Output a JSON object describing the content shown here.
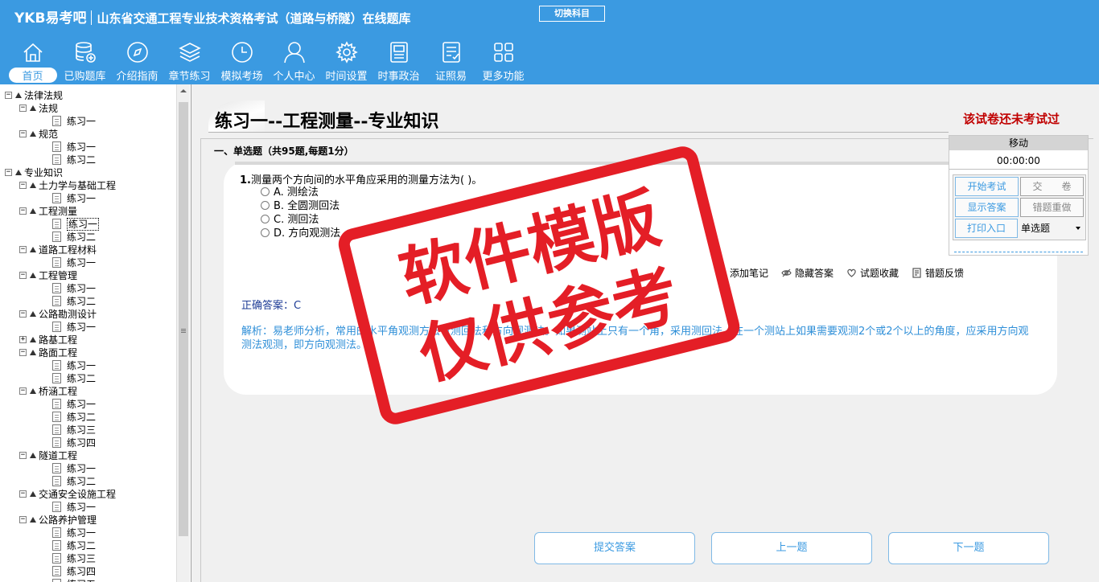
{
  "header": {
    "brand": "YKB易考吧",
    "title": "山东省交通工程专业技术资格考试（道路与桥隧）在线题库",
    "switch_label": "切换科目"
  },
  "toolbar": [
    {
      "label": "首页",
      "icon": "home-icon"
    },
    {
      "label": "已购题库",
      "icon": "database-icon"
    },
    {
      "label": "介绍指南",
      "icon": "compass-icon"
    },
    {
      "label": "章节练习",
      "icon": "layers-icon"
    },
    {
      "label": "模拟考场",
      "icon": "clock-icon"
    },
    {
      "label": "个人中心",
      "icon": "user-icon"
    },
    {
      "label": "时间设置",
      "icon": "gear-icon"
    },
    {
      "label": "时事政治",
      "icon": "news-icon"
    },
    {
      "label": "证照易",
      "icon": "checklist-icon"
    },
    {
      "label": "更多功能",
      "icon": "grid-icon"
    }
  ],
  "tree": [
    {
      "level": 0,
      "label": "法律法规",
      "type": "folder"
    },
    {
      "level": 1,
      "label": "法规",
      "type": "folder"
    },
    {
      "level": 2,
      "label": "练习一",
      "type": "doc"
    },
    {
      "level": 1,
      "label": "规范",
      "type": "folder"
    },
    {
      "level": 2,
      "label": "练习一",
      "type": "doc"
    },
    {
      "level": 2,
      "label": "练习二",
      "type": "doc"
    },
    {
      "level": 0,
      "label": "专业知识",
      "type": "folder"
    },
    {
      "level": 1,
      "label": "土力学与基础工程",
      "type": "folder"
    },
    {
      "level": 2,
      "label": "练习一",
      "type": "doc"
    },
    {
      "level": 1,
      "label": "工程测量",
      "type": "folder"
    },
    {
      "level": 2,
      "label": "练习一",
      "type": "doc",
      "selected": true
    },
    {
      "level": 2,
      "label": "练习二",
      "type": "doc"
    },
    {
      "level": 1,
      "label": "道路工程材料",
      "type": "folder"
    },
    {
      "level": 2,
      "label": "练习一",
      "type": "doc"
    },
    {
      "level": 1,
      "label": "工程管理",
      "type": "folder"
    },
    {
      "level": 2,
      "label": "练习一",
      "type": "doc"
    },
    {
      "level": 2,
      "label": "练习二",
      "type": "doc"
    },
    {
      "level": 1,
      "label": "公路勘测设计",
      "type": "folder"
    },
    {
      "level": 2,
      "label": "练习一",
      "type": "doc"
    },
    {
      "level": 1,
      "label": "路基工程",
      "type": "folder",
      "collapsed": true
    },
    {
      "level": 1,
      "label": "路面工程",
      "type": "folder"
    },
    {
      "level": 2,
      "label": "练习一",
      "type": "doc"
    },
    {
      "level": 2,
      "label": "练习二",
      "type": "doc"
    },
    {
      "level": 1,
      "label": "桥涵工程",
      "type": "folder"
    },
    {
      "level": 2,
      "label": "练习一",
      "type": "doc"
    },
    {
      "level": 2,
      "label": "练习二",
      "type": "doc"
    },
    {
      "level": 2,
      "label": "练习三",
      "type": "doc"
    },
    {
      "level": 2,
      "label": "练习四",
      "type": "doc"
    },
    {
      "level": 1,
      "label": "隧道工程",
      "type": "folder"
    },
    {
      "level": 2,
      "label": "练习一",
      "type": "doc"
    },
    {
      "level": 2,
      "label": "练习二",
      "type": "doc"
    },
    {
      "level": 1,
      "label": "交通安全设施工程",
      "type": "folder"
    },
    {
      "level": 2,
      "label": "练习一",
      "type": "doc"
    },
    {
      "level": 1,
      "label": "公路养护管理",
      "type": "folder"
    },
    {
      "level": 2,
      "label": "练习一",
      "type": "doc"
    },
    {
      "level": 2,
      "label": "练习二",
      "type": "doc"
    },
    {
      "level": 2,
      "label": "练习三",
      "type": "doc"
    },
    {
      "level": 2,
      "label": "练习四",
      "type": "doc"
    },
    {
      "level": 2,
      "label": "练习五",
      "type": "doc"
    }
  ],
  "paper": {
    "title": "练习一--工程测量--专业知识",
    "status": "该试卷还未考试过",
    "section": "一、单选题（共95题,每题1分）"
  },
  "question": {
    "number": "1.",
    "stem": "测量两个方向间的水平角应采用的测量方法为( )。",
    "options": [
      "A. 测绘法",
      "B. 全圆测回法",
      "C. 测回法",
      "D. 方向观测法"
    ],
    "actions": [
      "添加笔记",
      "隐藏答案",
      "试题收藏",
      "错题反馈"
    ],
    "answer": "正确答案：C",
    "analysis": "解析：易老师分析，常用的水平角观测方法有测回法和方向观测法。如果测站上只有一个角，采用测回法。在一个测站上如果需要观测2个或2个以上的角度，应采用方向观测法观测，即方向观测法。"
  },
  "nav": {
    "submit": "提交答案",
    "prev": "上一题",
    "next": "下一题"
  },
  "timer": {
    "head": "移动",
    "value": "00:00:00",
    "start": "开始考试",
    "handin": "交　　卷",
    "show_answer": "显示答案",
    "redo_wrong": "错题重做",
    "print": "打印入口",
    "qtype_selected": "单选题"
  },
  "stamp": {
    "line1": "软件模版",
    "line2": "仅供参考"
  },
  "colors": {
    "accent": "#3b9ae1",
    "status_red": "#c00000",
    "stamp_red": "#e41e26",
    "answer_blue": "#1e3c96",
    "analysis_blue": "#2f8fd8"
  }
}
